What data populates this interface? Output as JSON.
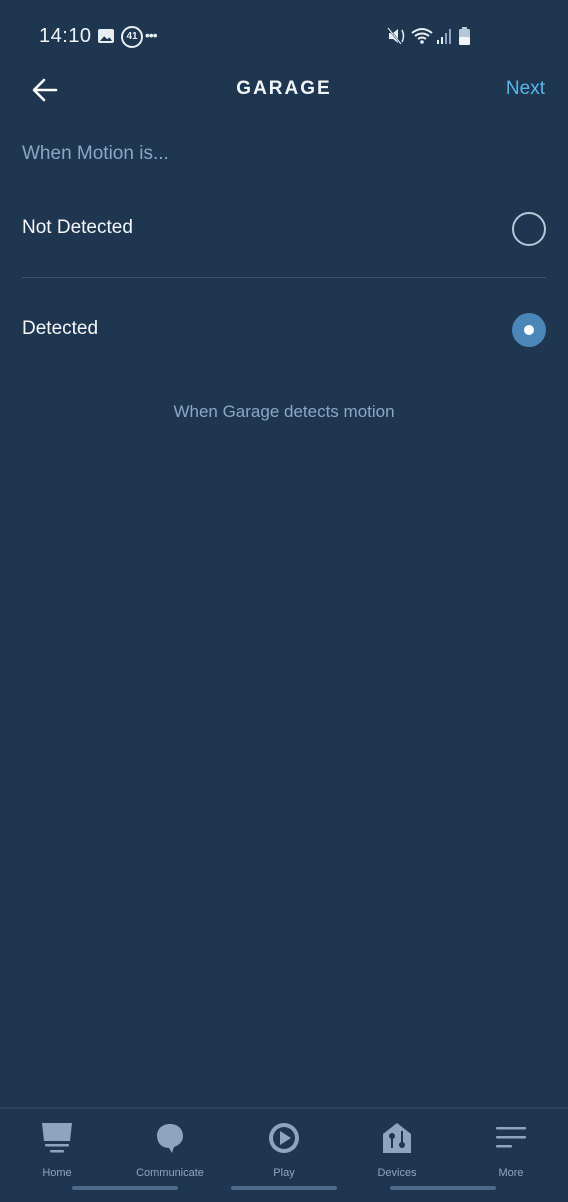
{
  "status_bar": {
    "time": "14:10",
    "notification_count": "41",
    "icons": [
      "gallery-icon",
      "notification-badge",
      "more-dots-icon",
      "mute-icon",
      "wifi-icon",
      "signal-icon",
      "battery-icon"
    ]
  },
  "header": {
    "back_icon": "arrow-left-icon",
    "title": "GARAGE",
    "next_label": "Next"
  },
  "section_label": "When Motion is...",
  "options": [
    {
      "label": "Not Detected",
      "selected": false
    },
    {
      "label": "Detected",
      "selected": true
    }
  ],
  "description": "When Garage detects motion",
  "bottom_nav": {
    "items": [
      {
        "label": "Home",
        "icon": "home-icon"
      },
      {
        "label": "Communicate",
        "icon": "chat-bubble-icon"
      },
      {
        "label": "Play",
        "icon": "play-icon"
      },
      {
        "label": "Devices",
        "icon": "devices-house-icon"
      },
      {
        "label": "More",
        "icon": "menu-icon"
      }
    ]
  },
  "colors": {
    "background": "#1f3651",
    "accent": "#5ab7eb",
    "radio_selected": "#4a87b8",
    "muted_text": "#8aa7c4"
  }
}
